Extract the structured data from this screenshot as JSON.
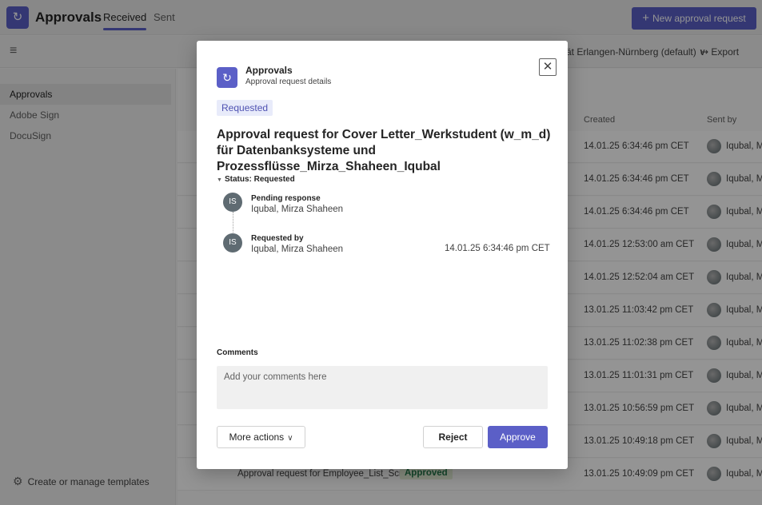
{
  "app": {
    "title": "Approvals",
    "icon": "approvals-icon",
    "tabs": [
      {
        "label": "Received",
        "active": true
      },
      {
        "label": "Sent",
        "active": false
      }
    ],
    "new_request_label": "New approval request",
    "accent": "#5b5fc7"
  },
  "toolbar": {
    "environment_label": "ät Erlangen-Nürnberg (default)",
    "export_label": "Export"
  },
  "sidebar": {
    "items": [
      {
        "label": "Approvals",
        "active": true
      },
      {
        "label": "Adobe Sign",
        "active": false
      },
      {
        "label": "DocuSign",
        "active": false
      }
    ],
    "templates_label": "Create or manage templates"
  },
  "table": {
    "headers": {
      "created": "Created",
      "sent_by": "Sent by"
    },
    "rows": [
      {
        "created": "14.01.25 6:34:46 pm CET",
        "sent_by": "Iqubal, M"
      },
      {
        "created": "14.01.25 6:34:46 pm CET",
        "sent_by": "Iqubal, M"
      },
      {
        "created": "14.01.25 6:34:46 pm CET",
        "sent_by": "Iqubal, M"
      },
      {
        "created": "14.01.25 12:53:00 am CET",
        "sent_by": "Iqubal, M"
      },
      {
        "created": "14.01.25 12:52:04 am CET",
        "sent_by": "Iqubal, M"
      },
      {
        "created": "13.01.25 11:03:42 pm CET",
        "sent_by": "Iqubal, M"
      },
      {
        "created": "13.01.25 11:02:38 pm CET",
        "sent_by": "Iqubal, M"
      },
      {
        "created": "13.01.25 11:01:31 pm CET",
        "sent_by": "Iqubal, M"
      },
      {
        "created": "13.01.25 10:56:59 pm CET",
        "sent_by": "Iqubal, M"
      },
      {
        "created": "13.01.25 10:49:18 pm CET",
        "sent_by": "Iqubal, M"
      },
      {
        "created": "13.01.25 10:49:09 pm CET",
        "sent_by": "Iqubal, M",
        "title": "Approval request for Employee_List_Scre",
        "status": "Approved"
      }
    ]
  },
  "modal": {
    "app_name": "Approvals",
    "subtitle": "Approval request details",
    "status_badge": "Requested",
    "heading": "Approval request for Cover Letter_Werkstudent (w_m_d) für Datenbanksysteme und Prozessflüsse_Mirza_Shaheen_Iqubal",
    "status_toggle": "Status: Requested",
    "steps": [
      {
        "initials": "IS",
        "label": "Pending response",
        "name": "Iqubal, Mirza Shaheen",
        "time": ""
      },
      {
        "initials": "IS",
        "label": "Requested by",
        "name": "Iqubal, Mirza Shaheen",
        "time": "14.01.25 6:34:46 pm CET"
      }
    ],
    "comments_label": "Comments",
    "comments_placeholder": "Add your comments here",
    "more_actions_label": "More actions",
    "reject_label": "Reject",
    "approve_label": "Approve"
  }
}
